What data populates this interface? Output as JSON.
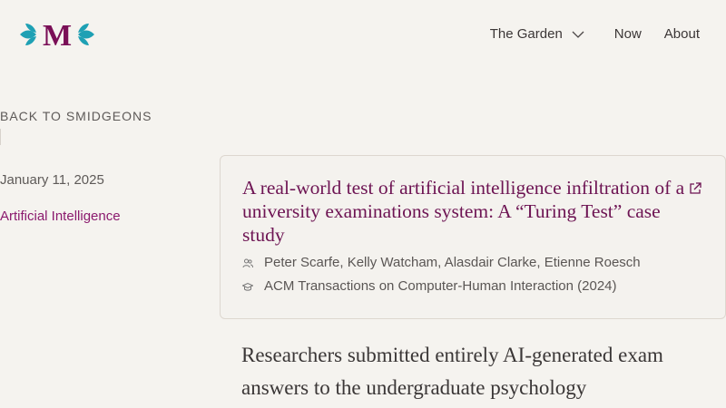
{
  "header": {
    "logo_letter": "M",
    "brand_color": "#7a0f57",
    "leaf_color": "#1ea0b4",
    "nav": {
      "garden_label": "The Garden",
      "now_label": "Now",
      "about_label": "About"
    }
  },
  "sidebar": {
    "back_label": "BACK TO SMIDGEONS",
    "date": "January 11, 2025",
    "category": "Artificial Intelligence"
  },
  "card": {
    "title": "A real-world test of artificial intelligence infiltration of a university examinations system: A “Turing Test” case study",
    "authors": "Peter Scarfe, Kelly Watcham, Alasdair Clarke, Etienne Roesch",
    "venue": "ACM Transactions on Computer-Human Interaction (2024)",
    "icons": {
      "authors": "users-icon",
      "venue": "graduation-cap-icon",
      "link": "external-link-icon"
    }
  },
  "body": {
    "lede": "Researchers submitted entirely AI-generated exam answers to the undergraduate psychology"
  }
}
